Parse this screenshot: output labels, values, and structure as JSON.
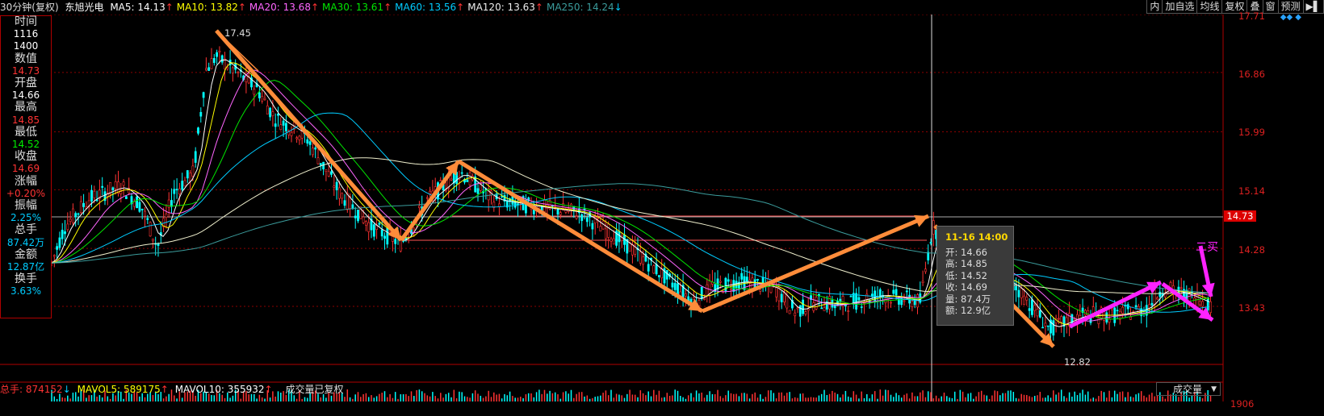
{
  "header": {
    "period": "30分钟(复权)",
    "stock_name": "东旭光电",
    "ma": [
      {
        "label": "MA5: 14.13",
        "arrow": "↑",
        "color": "#ffffff"
      },
      {
        "label": "MA10: 13.82",
        "arrow": "↑",
        "color": "#ffff00"
      },
      {
        "label": "MA20: 13.68",
        "arrow": "↑",
        "color": "#ff66ff"
      },
      {
        "label": "MA30: 13.61",
        "arrow": "↑",
        "color": "#00e600"
      },
      {
        "label": "MA60: 13.56",
        "arrow": "↑",
        "color": "#00ccff"
      },
      {
        "label": "MA120: 13.63",
        "arrow": "↑",
        "color": "#eeeeee"
      },
      {
        "label": "MA250: 14.24",
        "arrow": "↓",
        "color": "#3b9c9c"
      }
    ]
  },
  "toolbar": {
    "buttons": [
      "内",
      "加自选",
      "均线",
      "复权",
      "叠",
      "窗",
      "预测",
      "▶▌"
    ],
    "diamonds": "◆◆ ◆"
  },
  "info_panel": [
    {
      "label": "时间",
      "value": "1116",
      "value2": "1400",
      "color": "#ffffff"
    },
    {
      "label": "数值",
      "value": "14.73",
      "color": "#ff3333"
    },
    {
      "label": "开盘",
      "value": "14.66",
      "color": "#ffffff"
    },
    {
      "label": "最高",
      "value": "14.85",
      "color": "#ff3333"
    },
    {
      "label": "最低",
      "value": "14.52",
      "color": "#00ee00"
    },
    {
      "label": "收盘",
      "value": "14.69",
      "color": "#ff3333"
    },
    {
      "label": "涨幅",
      "value": "+0.20%",
      "color": "#ff3333"
    },
    {
      "label": "振幅",
      "value": "2.25%",
      "color": "#00ccff"
    },
    {
      "label": "总手",
      "value": "87.42万",
      "color": "#00ccff"
    },
    {
      "label": "金额",
      "value": "12.87亿",
      "color": "#00ccff"
    },
    {
      "label": "换手",
      "value": "3.63%",
      "color": "#00ccff"
    }
  ],
  "price_axis": {
    "labels": [
      "17.71",
      "16.86",
      "15.99",
      "15.14",
      "14.28",
      "13.43"
    ],
    "current": "14.73",
    "vol_label": "1906"
  },
  "annotations": {
    "high": "17.45",
    "low": "12.82",
    "buy_signal": "二买"
  },
  "tooltip": {
    "time": "11-16 14:00",
    "rows": [
      "开: 14.66",
      "高: 14.85",
      "低: 14.52",
      "收: 14.69",
      "量: 87.4万",
      "额: 12.9亿"
    ]
  },
  "volume_bar": {
    "total": "总手: 874152",
    "total_arrow": "↓",
    "mavol5": "MAVOL5: 589175",
    "mavol5_arrow": "↑",
    "mavol10": "MAVOL10: 355932",
    "mavol10_arrow": "↑",
    "note": "成交量已复权",
    "dropdown": "成交量"
  },
  "colors": {
    "up": "#ff3333",
    "down": "#00ffff",
    "grid": "#8b0000",
    "arrow_orange": "#ff8c3a",
    "arrow_magenta": "#ff22ff"
  }
}
